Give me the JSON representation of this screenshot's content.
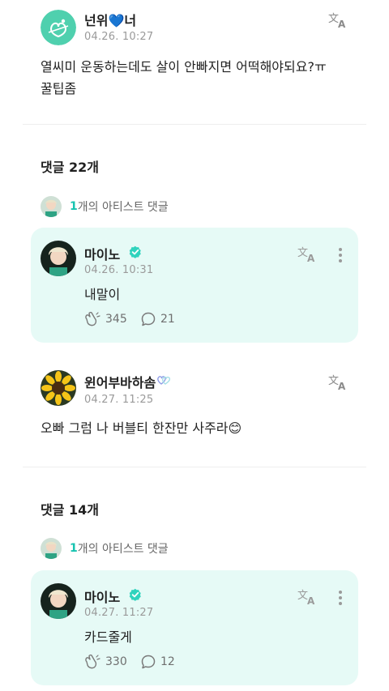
{
  "post": {
    "author": "넌위💙너",
    "time": "04.26. 10:27",
    "text_line1": "열씨미 운동하는데도 살이 안빠지면 어떡해야되요?ㅠ",
    "text_line2": "꿀팁좀"
  },
  "thread1": {
    "count_label": "댓글 22개",
    "artist_count": "1",
    "artist_label": "개의 아티스트 댓글",
    "artist_reply": {
      "name": "마이노",
      "time": "04.26. 10:31",
      "text": "내말이",
      "likes": "345",
      "comments": "21"
    },
    "fan_reply": {
      "name": "윈어부바하솜",
      "time": "04.27. 11:25",
      "text": "오빠 그럼 나 버블티 한잔만 사주라😊"
    }
  },
  "thread2": {
    "count_label": "댓글 14개",
    "artist_count": "1",
    "artist_label": "개의 아티스트 댓글",
    "artist_reply": {
      "name": "마이노",
      "time": "04.27. 11:27",
      "text": "카드줄게",
      "likes": "330",
      "comments": "12"
    }
  },
  "colors": {
    "accent": "#17c3b0",
    "card_bg": "#e6faf6",
    "verified": "#2fd3bd"
  }
}
